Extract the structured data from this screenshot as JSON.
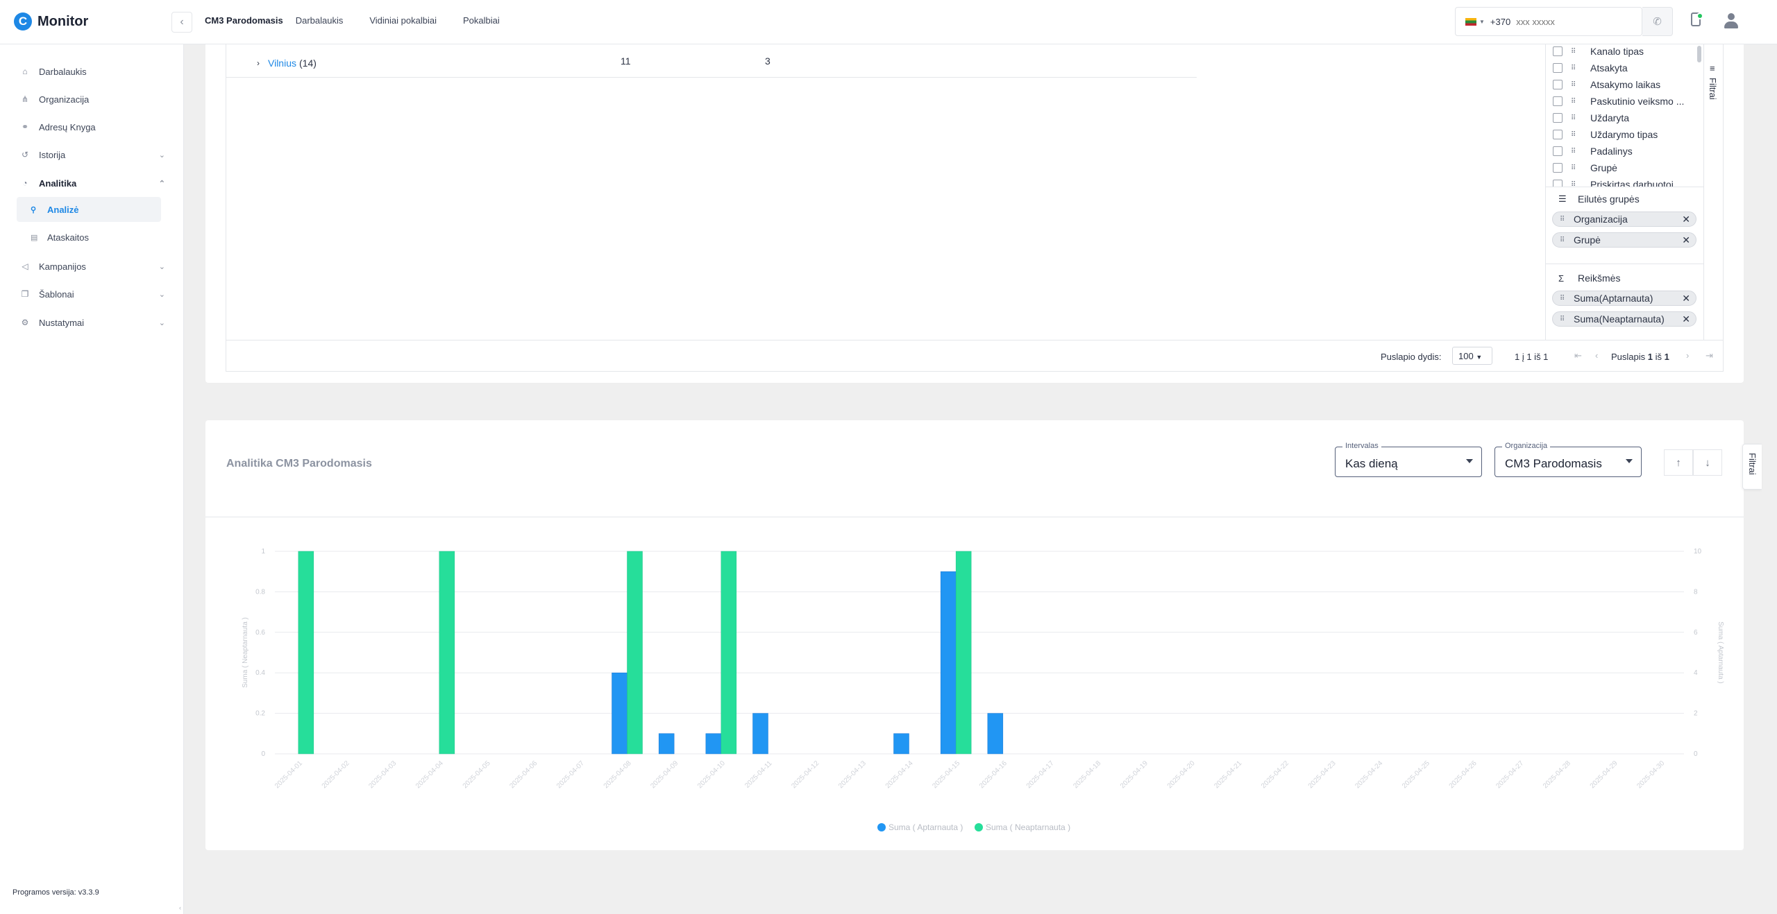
{
  "app": {
    "logo_letter": "C",
    "name": "Monitor",
    "version": "Programos versija: v3.3.9"
  },
  "header": {
    "tabs": [
      {
        "label": "CM3 Parodomasis",
        "active": true
      },
      {
        "label": "Darbalaukis"
      },
      {
        "label": "Vidiniai pokalbiai"
      },
      {
        "label": "Pokalbiai"
      }
    ],
    "phone_prefix": "+370",
    "phone_placeholder": "xxx xxxxx"
  },
  "sidebar": {
    "items": [
      {
        "label": "Darbalaukis",
        "icon": "home-icon"
      },
      {
        "label": "Organizacija",
        "icon": "org-icon"
      },
      {
        "label": "Adresų Knyga",
        "icon": "address-book-icon"
      },
      {
        "label": "Istorija",
        "icon": "history-icon",
        "expandable": true
      },
      {
        "label": "Analitika",
        "icon": "analytics-icon",
        "expandable": true,
        "open": true
      },
      {
        "label": "Analizė",
        "icon": "search-icon",
        "sub": true,
        "active": true
      },
      {
        "label": "Ataskaitos",
        "icon": "document-icon",
        "sub": true
      },
      {
        "label": "Kampanijos",
        "icon": "megaphone-icon",
        "expandable": true
      },
      {
        "label": "Šablonai",
        "icon": "template-icon",
        "expandable": true
      },
      {
        "label": "Nustatymai",
        "icon": "gear-icon",
        "expandable": true
      }
    ]
  },
  "table": {
    "row": {
      "name": "Vilnius",
      "count": "(14)",
      "col_a": "11",
      "col_b": "3"
    }
  },
  "tool_panel": {
    "columns": [
      "Kanalo tipas",
      "Atsakyta",
      "Atsakymo laikas",
      "Paskutinio veiksmo ...",
      "Uždaryta",
      "Uždarymo tipas",
      "Padalinys",
      "Grupė",
      "Priskirtas darbuotoj"
    ],
    "row_groups_title": "Eilutės grupės",
    "row_groups": [
      "Organizacija",
      "Grupė"
    ],
    "values_title": "Reikšmės",
    "values": [
      "Suma(Aptarnauta)",
      "Suma(Neaptarnauta)"
    ],
    "side_label": "Filtrai"
  },
  "pager": {
    "page_size_label": "Puslapio dydis:",
    "page_size": "100",
    "range": "1 į 1 iš 1",
    "page_prefix": "Puslapis",
    "page_current": "1",
    "page_mid": "iš",
    "page_total": "1"
  },
  "chart_card": {
    "title": "Analitika CM3 Parodomasis",
    "interval_label": "Intervalas",
    "interval_value": "Kas dieną",
    "org_label": "Organizacija",
    "org_value": "CM3 Parodomasis",
    "filters_label": "Filtrai"
  },
  "chart_data": {
    "type": "bar",
    "categories": [
      "2025-04-01",
      "2025-04-02",
      "2025-04-03",
      "2025-04-04",
      "2025-04-05",
      "2025-04-06",
      "2025-04-07",
      "2025-04-08",
      "2025-04-09",
      "2025-04-10",
      "2025-04-11",
      "2025-04-12",
      "2025-04-13",
      "2025-04-14",
      "2025-04-15",
      "2025-04-16",
      "2025-04-17",
      "2025-04-18",
      "2025-04-19",
      "2025-04-20",
      "2025-04-21",
      "2025-04-22",
      "2025-04-23",
      "2025-04-24",
      "2025-04-25",
      "2025-04-26",
      "2025-04-27",
      "2025-04-28",
      "2025-04-29",
      "2025-04-30"
    ],
    "series": [
      {
        "name": "Suma ( Aptarnauta )",
        "axis": "right",
        "color": "#2196f3",
        "values": [
          0,
          0,
          0,
          0,
          0,
          0,
          0,
          4,
          1,
          1,
          2,
          0,
          0,
          1,
          9,
          2,
          0,
          0,
          0,
          0,
          0,
          0,
          0,
          0,
          0,
          0,
          0,
          0,
          0,
          0
        ]
      },
      {
        "name": "Suma ( Neaptarnauta )",
        "axis": "left",
        "color": "#26de9a",
        "values": [
          1,
          0,
          0,
          1,
          0,
          0,
          0,
          1,
          0,
          1,
          0,
          0,
          0,
          0,
          1,
          0,
          0,
          0,
          0,
          0,
          0,
          0,
          0,
          0,
          0,
          0,
          0,
          0,
          0,
          0
        ]
      }
    ],
    "ylabel_left": "Suma ( Neaptarnauta )",
    "ylabel_right": "Suma ( Aptarnauta )",
    "ylim_left": [
      0,
      1
    ],
    "ylim_right": [
      0,
      10
    ],
    "yticks_left": [
      "0",
      "0.2",
      "0.4",
      "0.6",
      "0.8",
      "1"
    ],
    "yticks_right": [
      "0",
      "2",
      "4",
      "6",
      "8",
      "10"
    ],
    "grid": true,
    "legend": "bottom-center"
  }
}
